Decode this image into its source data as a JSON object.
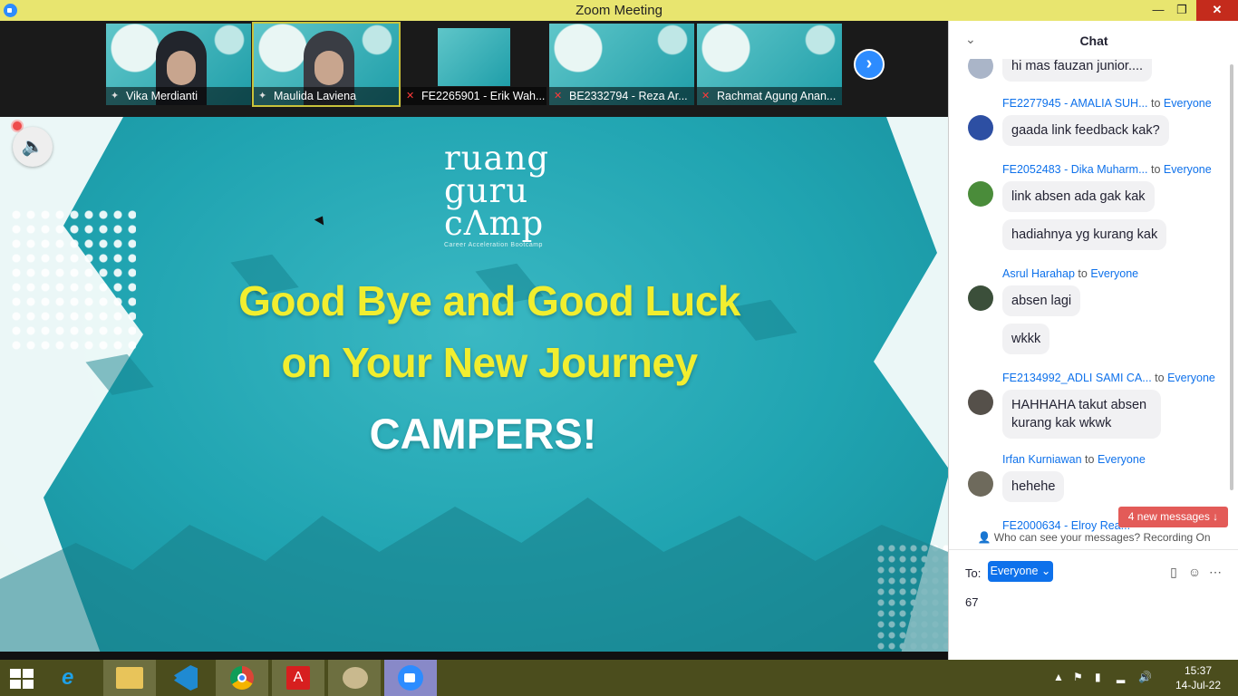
{
  "window": {
    "title": "Zoom Meeting",
    "minimize": "—",
    "restore": "❐",
    "close": "✕"
  },
  "participants": [
    {
      "name": "Vika Merdianti",
      "icon": "pin-icon"
    },
    {
      "name": "Maulida Laviena",
      "icon": "pin-icon"
    },
    {
      "name": "FE2265901 - Erik Wah...",
      "icon": "muted-mic-icon"
    },
    {
      "name": "BE2332794 - Reza Ar...",
      "icon": "muted-mic-icon"
    },
    {
      "name": "Rachmat Agung Anan...",
      "icon": "muted-mic-icon"
    }
  ],
  "slide": {
    "logo": [
      "ruang",
      "guru",
      "cΛmp"
    ],
    "logo_tagline": "Career Acceleration Bootcamp",
    "line1": "Good Bye and Good Luck",
    "line2": "on Your New Journey",
    "line3": "CAMPERS!"
  },
  "chat": {
    "title": "Chat",
    "to_word": "to",
    "everyone": "Everyone",
    "messages": [
      {
        "sender": "",
        "text": "hi mas fauzan junior...."
      },
      {
        "sender": "FE2277945 - AMALIA SUH...",
        "text": "gaada link feedback kak?"
      },
      {
        "sender": "FE2052483 - Dika Muharm...",
        "text": "link absen ada gak kak"
      },
      {
        "sender": "",
        "text": "hadiahnya yg kurang kak"
      },
      {
        "sender": "Asrul Harahap",
        "text": "absen lagi"
      },
      {
        "sender": "",
        "text": "wkkk"
      },
      {
        "sender": "FE2134992_ADLI SAMI CA...",
        "text": "HAHHAHA takut absen kurang kak wkwk"
      },
      {
        "sender": "Irfan Kurniawan",
        "text": "hehehe"
      },
      {
        "sender": "FE2000634 - Elroy Rea...",
        "text": ""
      }
    ],
    "new_messages": "4 new messages ↓",
    "who_can_see": "Who can see your messages? Recording On",
    "to_label": "To:",
    "to_value": "Everyone ⌄",
    "typed_text": "67"
  },
  "taskbar": {
    "apps": [
      "internet-explorer-icon",
      "file-explorer-icon",
      "vscode-icon",
      "chrome-icon",
      "acrobat-icon",
      "paint-icon",
      "zoom-icon"
    ],
    "time": "15:37",
    "date": "14-Jul-22"
  }
}
